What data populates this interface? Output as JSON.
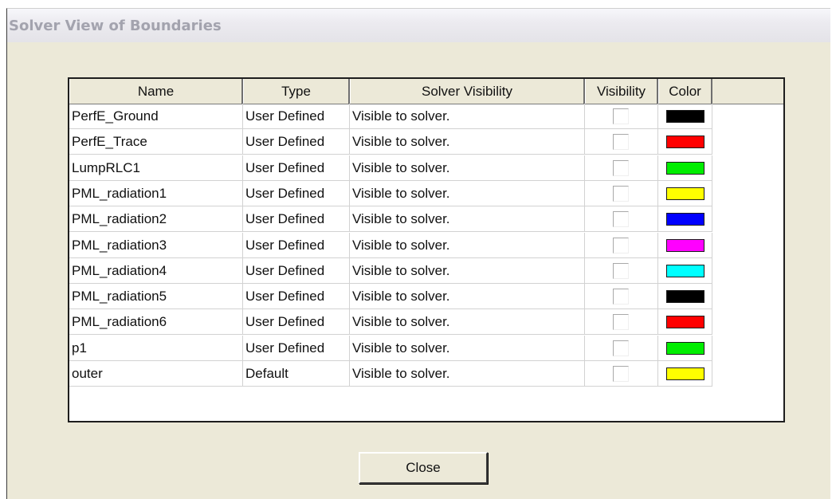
{
  "window": {
    "title": "Solver View of Boundaries"
  },
  "table": {
    "headers": {
      "name": "Name",
      "type": "Type",
      "solver_visibility": "Solver Visibility",
      "visibility": "Visibility",
      "color": "Color"
    },
    "rows": [
      {
        "name": "PerfE_Ground",
        "type": "User Defined",
        "solver_visibility": "Visible to solver.",
        "visible": false,
        "color": "#000000"
      },
      {
        "name": "PerfE_Trace",
        "type": "User Defined",
        "solver_visibility": "Visible to solver.",
        "visible": false,
        "color": "#ff0000"
      },
      {
        "name": "LumpRLC1",
        "type": "User Defined",
        "solver_visibility": "Visible to solver.",
        "visible": false,
        "color": "#00ee00"
      },
      {
        "name": "PML_radiation1",
        "type": "User Defined",
        "solver_visibility": "Visible to solver.",
        "visible": false,
        "color": "#ffff00"
      },
      {
        "name": "PML_radiation2",
        "type": "User Defined",
        "solver_visibility": "Visible to solver.",
        "visible": false,
        "color": "#0000ff"
      },
      {
        "name": "PML_radiation3",
        "type": "User Defined",
        "solver_visibility": "Visible to solver.",
        "visible": false,
        "color": "#ff00ff"
      },
      {
        "name": "PML_radiation4",
        "type": "User Defined",
        "solver_visibility": "Visible to solver.",
        "visible": false,
        "color": "#00ffff"
      },
      {
        "name": "PML_radiation5",
        "type": "User Defined",
        "solver_visibility": "Visible to solver.",
        "visible": false,
        "color": "#000000"
      },
      {
        "name": "PML_radiation6",
        "type": "User Defined",
        "solver_visibility": "Visible to solver.",
        "visible": false,
        "color": "#ff0000"
      },
      {
        "name": "p1",
        "type": "User Defined",
        "solver_visibility": "Visible to solver.",
        "visible": false,
        "color": "#00ee00"
      },
      {
        "name": "outer",
        "type": "Default",
        "solver_visibility": "Visible to solver.",
        "visible": false,
        "color": "#ffff00"
      }
    ]
  },
  "buttons": {
    "close_label": "Close"
  }
}
